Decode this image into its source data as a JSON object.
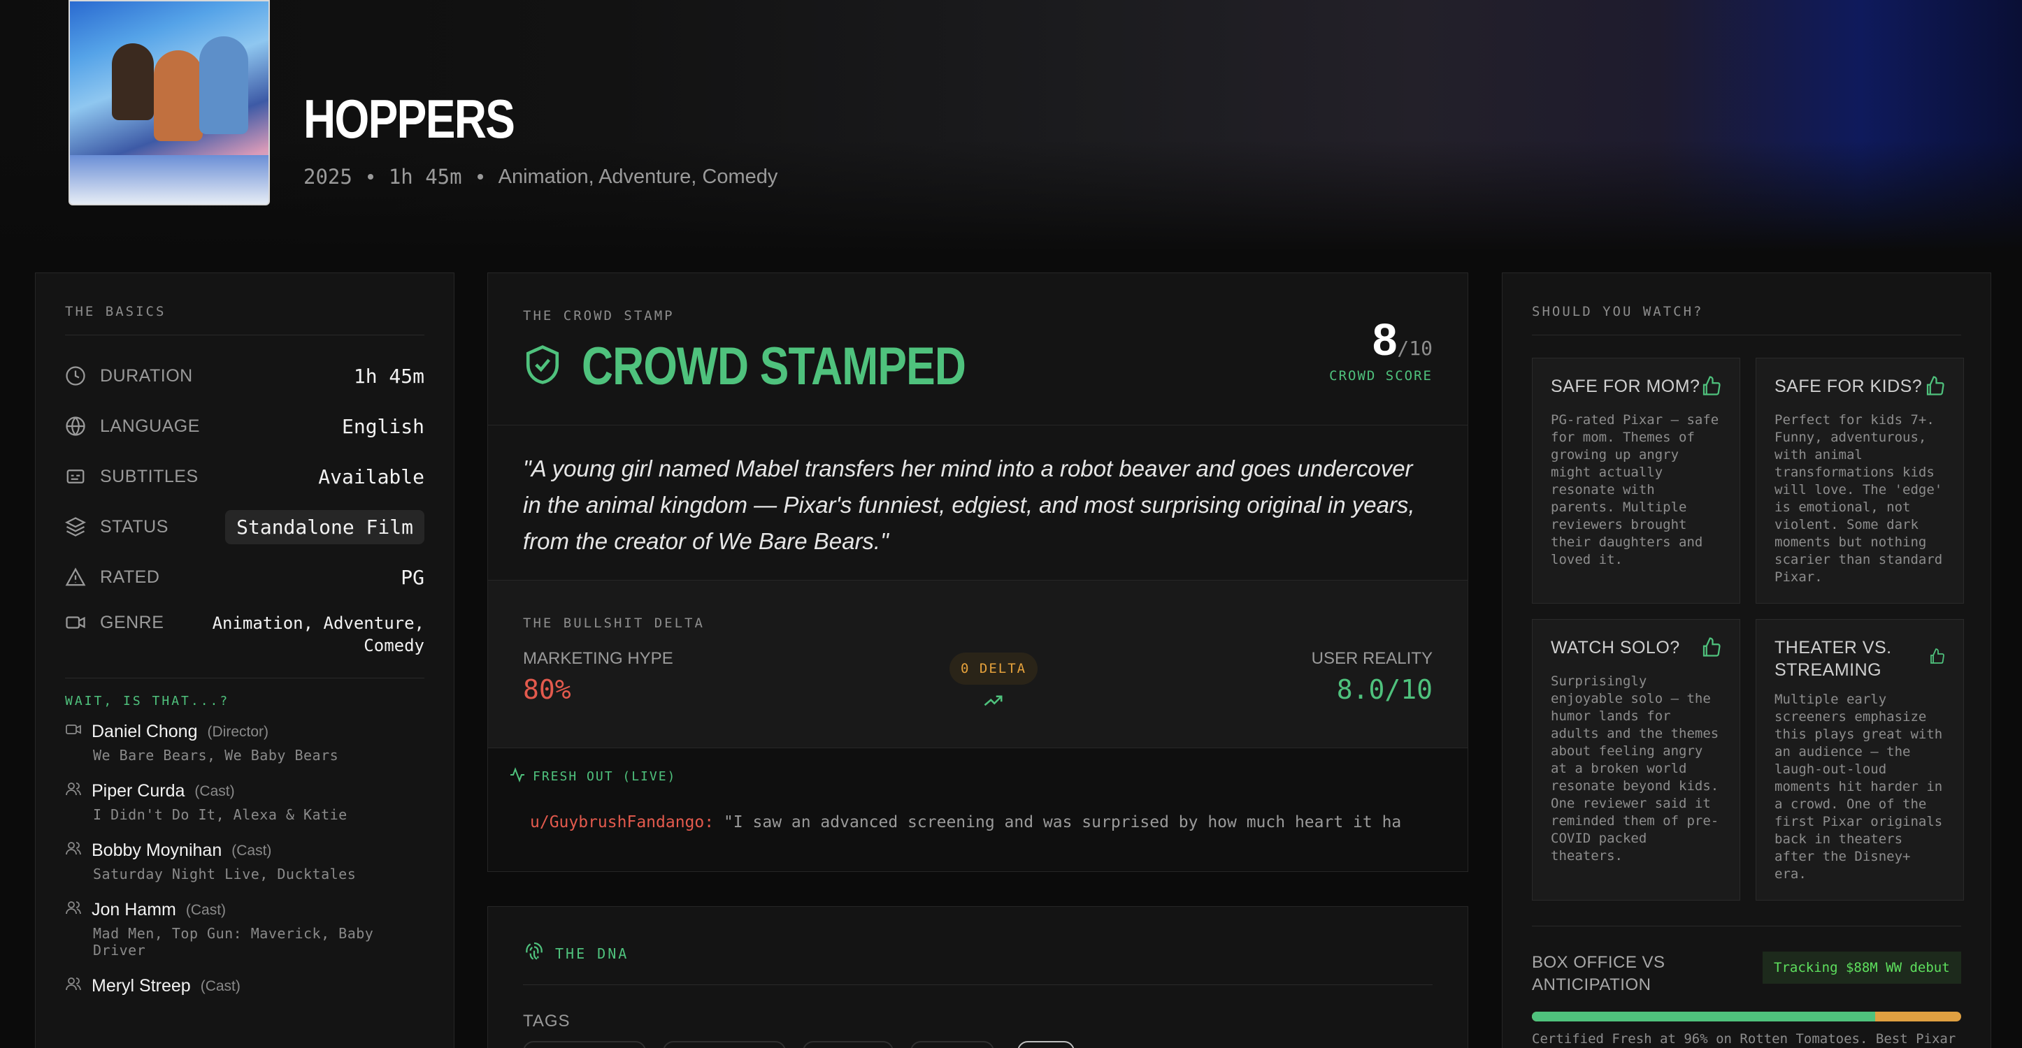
{
  "hero": {
    "title": "HOPPERS",
    "year": "2025",
    "runtime": "1h 45m",
    "genres": "Animation, Adventure, Comedy"
  },
  "basics": {
    "label": "THE BASICS",
    "rows": [
      {
        "key": "DURATION",
        "value": "1h 45m",
        "icon": "clock-icon"
      },
      {
        "key": "LANGUAGE",
        "value": "English",
        "icon": "globe-icon"
      },
      {
        "key": "SUBTITLES",
        "value": "Available",
        "icon": "subtitles-icon"
      },
      {
        "key": "STATUS",
        "value": "Standalone Film",
        "icon": "layers-icon"
      },
      {
        "key": "RATED",
        "value": "PG",
        "icon": "warning-icon"
      },
      {
        "key": "GENRE",
        "value": "Animation, Adventure,\nComedy",
        "icon": "video-icon"
      }
    ],
    "wait_label": "WAIT, IS THAT...?",
    "people": [
      {
        "name": "Daniel Chong",
        "role": "(Director)",
        "works": "We Bare Bears, We Baby Bears",
        "icon": "video-icon"
      },
      {
        "name": "Piper Curda",
        "role": "(Cast)",
        "works": "I Didn't Do It, Alexa & Katie",
        "icon": "users-icon"
      },
      {
        "name": "Bobby Moynihan",
        "role": "(Cast)",
        "works": "Saturday Night Live, Ducktales",
        "icon": "users-icon"
      },
      {
        "name": "Jon Hamm",
        "role": "(Cast)",
        "works": "Mad Men, Top Gun: Maverick, Baby Driver",
        "icon": "users-icon"
      },
      {
        "name": "Meryl Streep",
        "role": "(Cast)",
        "works": "",
        "icon": "users-icon"
      }
    ]
  },
  "stamp": {
    "label": "THE CROWD STAMP",
    "title": "CROWD STAMPED",
    "score": "8",
    "score_den": "/10",
    "score_label": "CROWD SCORE",
    "quote": "\"A young girl named Mabel transfers her mind into a robot beaver and goes undercover in the animal kingdom — Pixar's funniest, edgiest, and most surprising original in years, from the creator of We Bare Bears.\""
  },
  "delta": {
    "label": "THE BULLSHIT DELTA",
    "hype_label": "MARKETING HYPE",
    "hype_value": "80%",
    "badge": "0 DELTA",
    "reality_label": "USER REALITY",
    "reality_value": "8.0/10"
  },
  "fresh": {
    "label": "FRESH OUT (LIVE)",
    "user": "u/GuybrushFandango:",
    "text": " \"I saw an advanced screening and was surprised by how much heart it ha"
  },
  "dna": {
    "label": "THE DNA",
    "tags_label": "TAGS"
  },
  "watch": {
    "label": "SHOULD YOU WATCH?",
    "cards": [
      {
        "title": "SAFE FOR MOM?",
        "body": "PG-rated Pixar — safe for mom. Themes of growing up angry might actually resonate with parents. Multiple reviewers brought their daughters and loved it."
      },
      {
        "title": "SAFE FOR KIDS?",
        "body": "Perfect for kids 7+. Funny, adventurous, with animal transformations kids will love. The 'edge' is emotional, not violent. Some dark moments but nothing scarier than standard Pixar."
      },
      {
        "title": "WATCH SOLO?",
        "body": "Surprisingly enjoyable solo — the humor lands for adults and the themes about feeling angry at a broken world resonate beyond kids. One reviewer said it reminded them of pre-COVID packed theaters."
      },
      {
        "title": "THEATER VS. STREAMING",
        "body": "Multiple early screeners emphasize this plays great with an audience — the laugh-out-loud moments hit harder in a crowd. One of the first Pixar originals back in theaters after the Disney+ era."
      }
    ],
    "box_title": "BOX OFFICE VS ANTICIPATION",
    "tracking": "Tracking $88M WW debut",
    "bar_fraction": 0.8,
    "note": "Certified Fresh at 96% on Rotten Tomatoes. Best Pixar"
  },
  "colors": {
    "accent_green": "#4fc27d",
    "hype_red": "#e35a4d",
    "delta_orange": "#e6a23c"
  }
}
